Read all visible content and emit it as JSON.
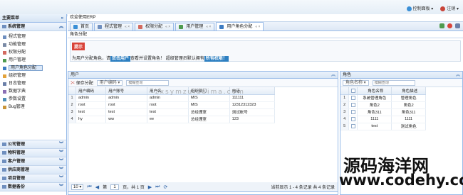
{
  "topbar": {
    "control_panel": "控制面板",
    "logout": "注销"
  },
  "sidebar": {
    "title": "主要菜单",
    "section": "系统管理",
    "items": [
      {
        "label": "程式管理",
        "icon": "document-icon",
        "color": "#6f8fbf"
      },
      {
        "label": "功能管理",
        "icon": "gear-icon",
        "color": "#7a8aa5"
      },
      {
        "label": "权限分配",
        "icon": "lock-icon",
        "color": "#d36a5f"
      },
      {
        "label": "用户管理",
        "icon": "user-icon",
        "color": "#4e9a4e"
      },
      {
        "label": "用户角色分配",
        "icon": "user-role-icon",
        "color": "#3e7cc2"
      },
      {
        "label": "组织管理",
        "icon": "org-icon",
        "color": "#e3a23a"
      },
      {
        "label": "日志管理",
        "icon": "log-icon",
        "color": "#6b7fa8"
      },
      {
        "label": "数据字典",
        "icon": "dictionary-icon",
        "color": "#8b6fb5"
      },
      {
        "label": "参数设置",
        "icon": "settings-icon",
        "color": "#4e8fb8"
      },
      {
        "label": "Bug管理",
        "icon": "bug-icon",
        "color": "#c9953a"
      }
    ],
    "bottom_sections": [
      "公司管理",
      "物料管理",
      "客户管理",
      "供应商管理",
      "项目管理",
      "数据备份"
    ]
  },
  "main": {
    "welcome": "欢迎使用ERP",
    "tabs": [
      {
        "label": "首页",
        "icon": "home-icon",
        "closable": false
      },
      {
        "label": "程式管理",
        "icon": "document-icon",
        "closable": true
      },
      {
        "label": "权限分配",
        "icon": "lock-icon",
        "closable": true
      },
      {
        "label": "用户管理",
        "icon": "user-icon",
        "closable": true
      },
      {
        "label": "用户角色分配",
        "icon": "user-role-icon",
        "closable": true
      }
    ],
    "breadcrumb": "角色分配",
    "tip": {
      "badge": "提示",
      "prefix": "为用户分配角色，请",
      "highlight1": "双击用户",
      "middle": "查看并设置角色！ 超级管理员默认拥有",
      "highlight2": "所有权限！"
    }
  },
  "users_panel": {
    "title": "用户",
    "save_label": "保存分配",
    "filter_select": "用户编码",
    "search_placeholder": "模糊查询",
    "columns": [
      "用户编码",
      "用户账号",
      "用户名",
      "组织部门",
      "电话"
    ],
    "rows": [
      [
        "admin",
        "admin",
        "admin",
        "MIS",
        "111111"
      ],
      [
        "root",
        "root",
        "root",
        "MIS",
        "12312312323"
      ],
      [
        "test",
        "test",
        "test",
        "总经理室",
        "测试帐号"
      ],
      [
        "hy",
        "ww",
        "ee",
        "总经理室",
        "123"
      ]
    ]
  },
  "roles_panel": {
    "title": "角色",
    "filter_select": "角色名称",
    "search_placeholder": "模糊查询",
    "columns": [
      "角色名称",
      "角色描述"
    ],
    "rows": [
      [
        "系统管理角色",
        "管理角色"
      ],
      [
        "角色2",
        "角色2"
      ],
      [
        "角色311",
        "角色311"
      ],
      [
        "1111",
        "1111"
      ],
      [
        "test",
        "测试角色"
      ]
    ]
  },
  "pager": {
    "page_size": "10",
    "page_label": "第",
    "page_value": "1",
    "page_total": "页，共 1 页",
    "info": "当前显示 1 - 4 条记录 共 4 条记录"
  },
  "watermarks": {
    "center": "zxsymzuidaima.com",
    "cn": "源码海洋网",
    "url": "www.codehy.com"
  }
}
